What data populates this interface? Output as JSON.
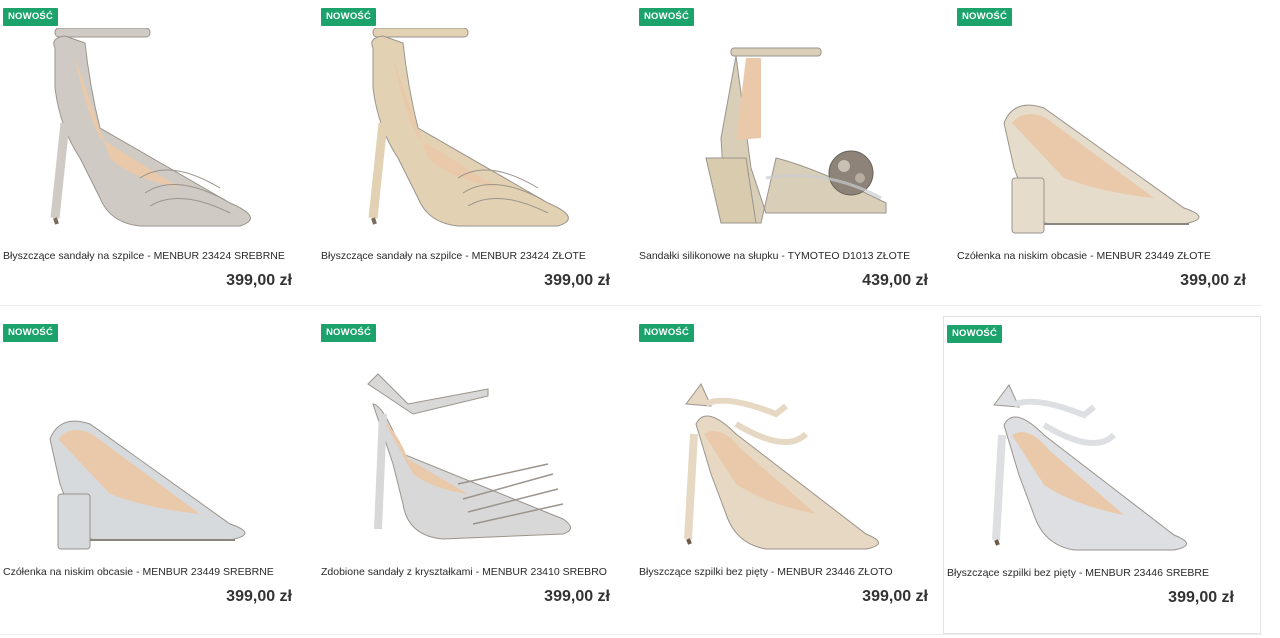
{
  "products": [
    {
      "badge": "NOWOŚĆ",
      "name": "Błyszczące sandały na szpilce - MENBUR 23424 SREBRNE",
      "price": "399,00 zł",
      "color": "#cfcac4",
      "style": "sandal-ankle"
    },
    {
      "badge": "NOWOŚĆ",
      "name": "Błyszczące sandały na szpilce - MENBUR 23424 ZŁOTE",
      "price": "399,00 zł",
      "color": "#e2d2b3",
      "style": "sandal-ankle"
    },
    {
      "badge": "NOWOŚĆ",
      "name": "Sandałki silikonowe na słupku - TYMOTEO D1013 ZŁOTE",
      "price": "439,00 zł",
      "color": "#d9cfb8",
      "style": "sandal-block"
    },
    {
      "badge": "NOWOŚĆ",
      "name": "Czółenka na niskim obcasie - MENBUR 23449 ZŁOTE",
      "price": "399,00 zł",
      "color": "#e6dccb",
      "style": "pump"
    },
    {
      "badge": "NOWOŚĆ",
      "name": "Czółenka na niskim obcasie - MENBUR 23449 SREBRNE",
      "price": "399,00 zł",
      "color": "#d7dadd",
      "style": "pump"
    },
    {
      "badge": "NOWOŚĆ",
      "name": "Zdobione sandały z kryształkami - MENBUR 23410 SREBRO",
      "price": "399,00 zł",
      "color": "#d8d8d8",
      "style": "sandal-strappy"
    },
    {
      "badge": "NOWOŚĆ",
      "name": "Błyszczące szpilki bez pięty - MENBUR 23446 ZŁOTO",
      "price": "399,00 zł",
      "color": "#e6d8c2",
      "style": "slingback"
    },
    {
      "badge": "NOWOŚĆ",
      "name": "Błyszczące szpilki bez pięty - MENBUR 23446 SREBRE",
      "price": "399,00 zł",
      "color": "#dddfe2",
      "style": "slingback"
    }
  ]
}
